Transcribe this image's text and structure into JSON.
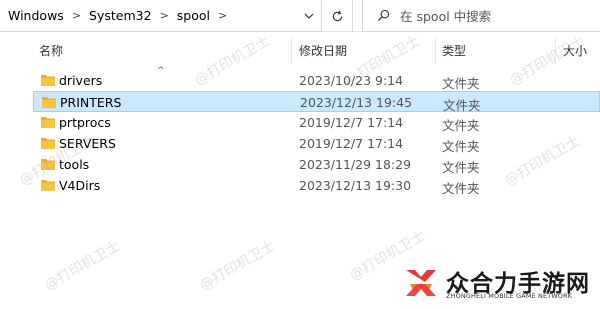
{
  "address_bar": {
    "breadcrumbs": [
      "Windows",
      "System32",
      "spool"
    ],
    "refresh_icon": "refresh-icon",
    "dropdown_icon": "chevron-down-icon"
  },
  "search": {
    "placeholder": "在 spool 中搜索",
    "icon": "search-icon"
  },
  "columns": {
    "name": "名称",
    "date": "修改日期",
    "type": "类型",
    "size": "大小"
  },
  "files": [
    {
      "name": "drivers",
      "date": "2023/10/23 9:14",
      "type": "文件夹",
      "selected": false
    },
    {
      "name": "PRINTERS",
      "date": "2023/12/13 19:45",
      "type": "文件夹",
      "selected": true
    },
    {
      "name": "prtprocs",
      "date": "2019/12/7 17:14",
      "type": "文件夹",
      "selected": false
    },
    {
      "name": "SERVERS",
      "date": "2019/12/7 17:14",
      "type": "文件夹",
      "selected": false
    },
    {
      "name": "tools",
      "date": "2023/11/29 18:29",
      "type": "文件夹",
      "selected": false
    },
    {
      "name": "V4Dirs",
      "date": "2023/12/13 19:30",
      "type": "文件夹",
      "selected": false
    }
  ],
  "watermark": "@打印机卫士",
  "logo": {
    "name": "众合力手游网",
    "tagline": "ZHONGHELI MOBILE GAME NETWORK"
  },
  "colors": {
    "selected_bg": "#cce8ff",
    "selected_border": "#99d1ff",
    "folder": "#f5c542",
    "logo_red": "#e5393b",
    "logo_orange": "#f08a24"
  }
}
